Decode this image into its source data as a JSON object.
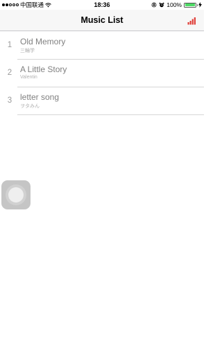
{
  "status_bar": {
    "carrier": "中国联通",
    "time": "18:36",
    "battery": "100%",
    "signal_bars_filled": 2,
    "signal_bars_total": 5,
    "battery_color": "#4cd964"
  },
  "nav": {
    "title": "Music List",
    "chart_icon_color": "#e0403a"
  },
  "songs": [
    {
      "index": "1",
      "title": "Old Memory",
      "artist": "三輪学"
    },
    {
      "index": "2",
      "title": "A Little Story",
      "artist": "Valentin"
    },
    {
      "index": "3",
      "title": "letter song",
      "artist": "ヲタみん"
    }
  ]
}
